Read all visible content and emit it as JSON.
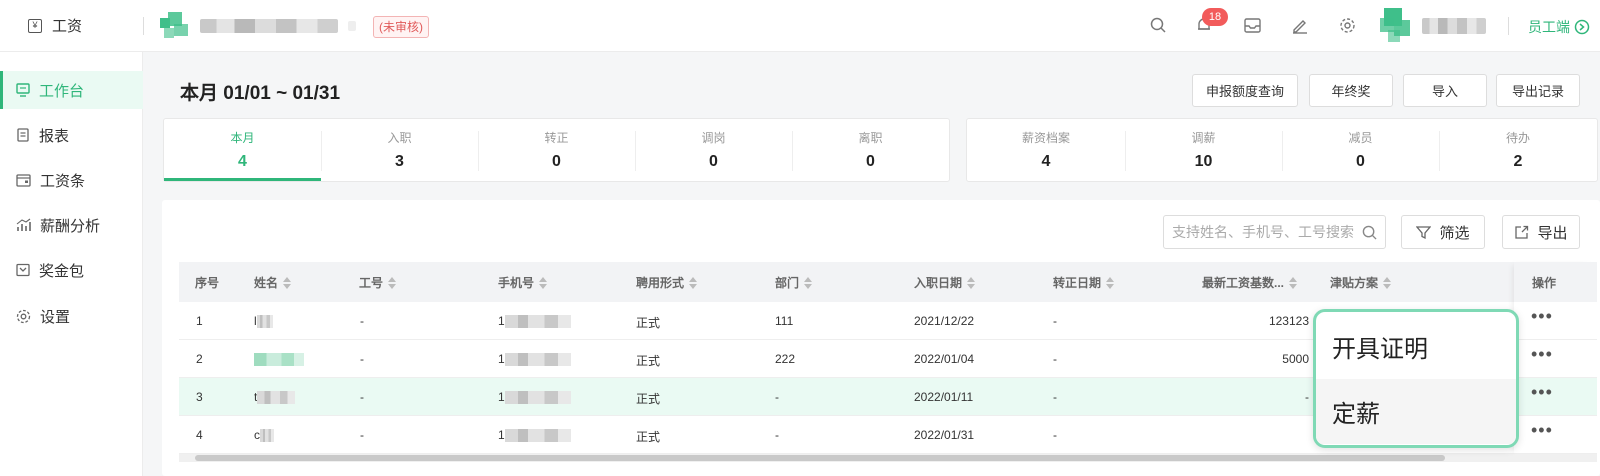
{
  "topbar": {
    "app_label": "工资",
    "status_badge": "(未审核)",
    "notification_count": "18",
    "staff_link": "员工端"
  },
  "sidebar": {
    "items": [
      {
        "label": "工作台",
        "icon": "monitor-icon",
        "active": true
      },
      {
        "label": "报表",
        "icon": "report-icon"
      },
      {
        "label": "工资条",
        "icon": "wallet-icon"
      },
      {
        "label": "薪酬分析",
        "icon": "chart-icon"
      },
      {
        "label": "奖金包",
        "icon": "gift-box-icon"
      },
      {
        "label": "设置",
        "icon": "gear-icon"
      }
    ]
  },
  "main": {
    "title": "本月 01/01 ~ 01/31",
    "top_buttons": [
      "申报额度查询",
      "年终奖",
      "导入",
      "导出记录"
    ],
    "stats_left": [
      {
        "label": "本月",
        "value": "4"
      },
      {
        "label": "入职",
        "value": "3"
      },
      {
        "label": "转正",
        "value": "0"
      },
      {
        "label": "调岗",
        "value": "0"
      },
      {
        "label": "离职",
        "value": "0"
      }
    ],
    "stats_right": [
      {
        "label": "薪资档案",
        "value": "4"
      },
      {
        "label": "调薪",
        "value": "10"
      },
      {
        "label": "减员",
        "value": "0"
      },
      {
        "label": "待办",
        "value": "2"
      }
    ],
    "search_placeholder": "支持姓名、手机号、工号搜索",
    "filter_label": "筛选",
    "export_label": "导出"
  },
  "table": {
    "columns": [
      "序号",
      "姓名",
      "工号",
      "手机号",
      "聘用形式",
      "部门",
      "入职日期",
      "转正日期",
      "最新工资基数...",
      "津贴方案",
      "操作"
    ],
    "rows": [
      {
        "index": "1",
        "name_prefix": "l",
        "job_no": "-",
        "phone_prefix": "1",
        "employment": "正式",
        "dept": "111",
        "hire_date": "2021/12/22",
        "regular_date": "-",
        "salary_base": "123123"
      },
      {
        "index": "2",
        "name_prefix": "",
        "job_no": "-",
        "phone_prefix": "1",
        "employment": "正式",
        "dept": "222",
        "hire_date": "2022/01/04",
        "regular_date": "-",
        "salary_base": "5000"
      },
      {
        "index": "3",
        "name_prefix": "t",
        "job_no": "-",
        "phone_prefix": "1",
        "employment": "正式",
        "dept": "-",
        "hire_date": "2022/01/11",
        "regular_date": "-",
        "salary_base": "-"
      },
      {
        "index": "4",
        "name_prefix": "c",
        "job_no": "-",
        "phone_prefix": "1",
        "employment": "正式",
        "dept": "-",
        "hire_date": "2022/01/31",
        "regular_date": "-",
        "salary_base": ""
      }
    ],
    "more_glyph": "•••"
  },
  "popover": {
    "items": [
      "开具证明",
      "定薪"
    ]
  },
  "colors": {
    "accent": "#2fb67a",
    "badge_red": "#f25b5b",
    "popover_border": "#7fd9b5"
  }
}
